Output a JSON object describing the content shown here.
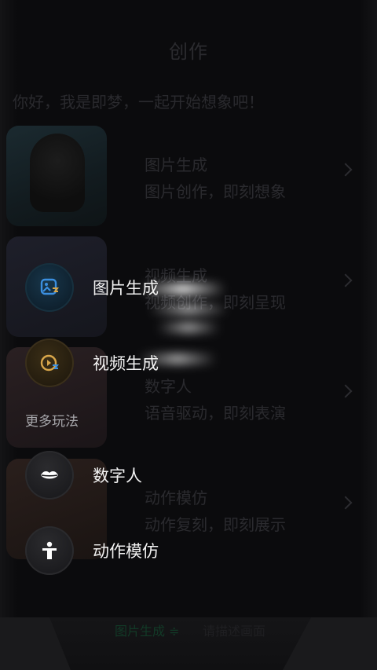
{
  "page": {
    "title": "创作",
    "greeting": "你好，我是即梦，一起开始想象吧！"
  },
  "cards": [
    {
      "title": "图片生成",
      "subtitle": "图片创作，即刻想象"
    },
    {
      "title": "视频生成",
      "subtitle": "视频创作，即刻呈现"
    },
    {
      "title": "数字人",
      "subtitle": "语音驱动，即刻表演"
    },
    {
      "title": "动作模仿",
      "subtitle": "动作复刻，即刻展示"
    }
  ],
  "bottom": {
    "mode_label": "图片生成 ≑",
    "input_placeholder": "请描述画面"
  },
  "menu": {
    "items": [
      {
        "label": "图片生成",
        "icon": "image-generate-icon"
      },
      {
        "label": "视频生成",
        "icon": "video-generate-icon"
      }
    ],
    "more_label": "更多玩法",
    "more_items": [
      {
        "label": "数字人",
        "icon": "lips-icon"
      },
      {
        "label": "动作模仿",
        "icon": "person-icon"
      }
    ]
  },
  "colors": {
    "blue_accent": "#2f7fd1",
    "gold_accent": "#d8a64a"
  }
}
